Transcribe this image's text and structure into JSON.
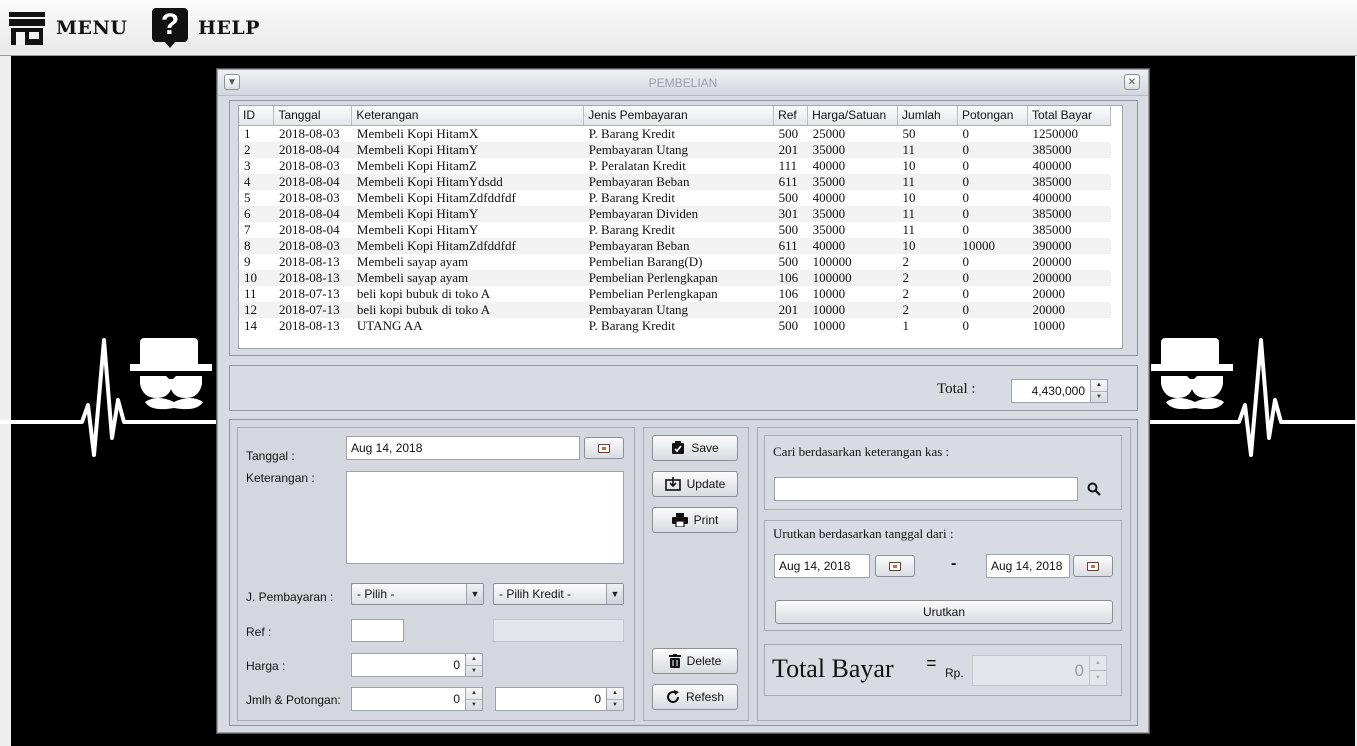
{
  "topbar": {
    "menu_label": "MENU",
    "help_label": "HELP",
    "help_glyph": "?"
  },
  "window": {
    "title": "PEMBELIAN"
  },
  "table": {
    "columns": [
      "ID",
      "Tanggal",
      "Keterangan",
      "Jenis Pembayaran",
      "Ref",
      "Harga/Satuan",
      "Jumlah",
      "Potongan",
      "Total Bayar"
    ],
    "rows": [
      [
        "1",
        "2018-08-03",
        "Membeli Kopi HitamX",
        "P. Barang Kredit",
        "500",
        "25000",
        "50",
        "0",
        "1250000"
      ],
      [
        "2",
        "2018-08-04",
        "Membeli Kopi HitamY",
        "Pembayaran Utang",
        "201",
        "35000",
        "11",
        "0",
        "385000"
      ],
      [
        "3",
        "2018-08-03",
        "Membeli Kopi HitamZ",
        "P. Peralatan Kredit",
        "111",
        "40000",
        "10",
        "0",
        "400000"
      ],
      [
        "4",
        "2018-08-04",
        "Membeli Kopi HitamYdsdd",
        "Pembayaran Beban",
        "611",
        "35000",
        "11",
        "0",
        "385000"
      ],
      [
        "5",
        "2018-08-03",
        "Membeli Kopi HitamZdfddfdf",
        "P. Barang Kredit",
        "500",
        "40000",
        "10",
        "0",
        "400000"
      ],
      [
        "6",
        "2018-08-04",
        "Membeli Kopi HitamY",
        "Pembayaran Dividen",
        "301",
        "35000",
        "11",
        "0",
        "385000"
      ],
      [
        "7",
        "2018-08-04",
        "Membeli Kopi HitamY",
        "P. Barang Kredit",
        "500",
        "35000",
        "11",
        "0",
        "385000"
      ],
      [
        "8",
        "2018-08-03",
        "Membeli Kopi HitamZdfddfdf",
        "Pembayaran Beban",
        "611",
        "40000",
        "10",
        "10000",
        "390000"
      ],
      [
        "9",
        "2018-08-13",
        "Membeli sayap ayam",
        "Pembelian Barang(D)",
        "500",
        "100000",
        "2",
        "0",
        "200000"
      ],
      [
        "10",
        "2018-08-13",
        "Membeli sayap ayam",
        "Pembelian Perlengkapan",
        "106",
        "100000",
        "2",
        "0",
        "200000"
      ],
      [
        "11",
        "2018-07-13",
        "beli kopi bubuk di toko A",
        "Pembelian Perlengkapan",
        "106",
        "10000",
        "2",
        "0",
        "20000"
      ],
      [
        "12",
        "2018-07-13",
        "beli kopi bubuk di toko A",
        "Pembayaran Utang",
        "201",
        "10000",
        "2",
        "0",
        "20000"
      ],
      [
        "14",
        "2018-08-13",
        "UTANG AA",
        "P. Barang Kredit",
        "500",
        "10000",
        "1",
        "0",
        "10000"
      ]
    ]
  },
  "total": {
    "label": "Total :",
    "value": "4,430,000"
  },
  "form": {
    "tanggal_label": "Tanggal :",
    "tanggal_value": "Aug 14, 2018",
    "keterangan_label": "Keterangan :",
    "keterangan_value": "",
    "jpembayaran_label": "J. Pembayaran :",
    "jpembayaran_value": "- Pilih -",
    "kredit_value": "- Pilih Kredit -",
    "ref_label": "Ref :",
    "ref_value": "",
    "harga_label": "Harga :",
    "harga_value": "0",
    "jumlah_label": "Jmlh & Potongan:",
    "jumlah_value": "0",
    "potongan_value": "0"
  },
  "actions": {
    "save": "Save",
    "update": "Update",
    "print": "Print",
    "delete": "Delete",
    "refresh": "Refesh"
  },
  "search": {
    "label": "Cari berdasarkan keterangan kas :",
    "value": ""
  },
  "sort": {
    "label": "Urutkan berdasarkan tanggal dari :",
    "from": "Aug 14, 2018",
    "separator": "-",
    "to": "Aug 14, 2018",
    "button": "Urutkan"
  },
  "total_bayar": {
    "label": "Total Bayar",
    "equals": "=",
    "currency": "Rp.",
    "value": "0"
  }
}
